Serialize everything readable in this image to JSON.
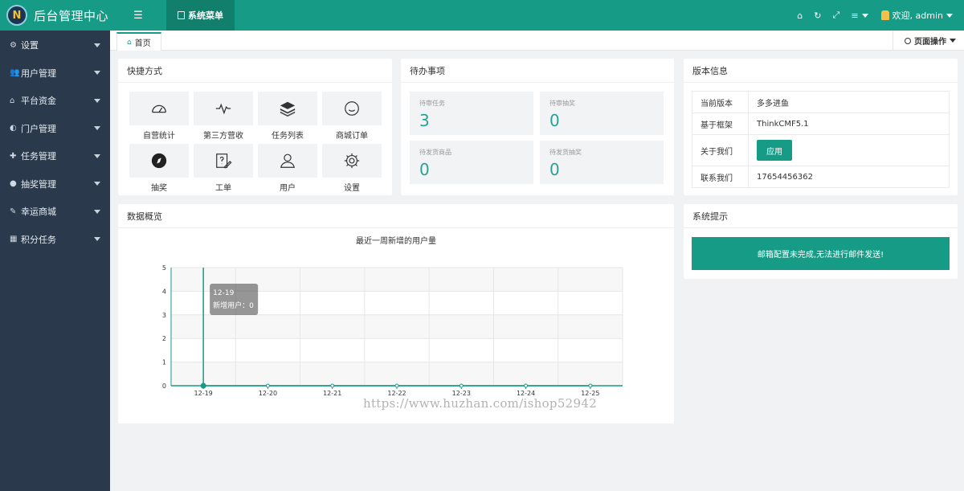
{
  "app": {
    "title": "后台管理中心",
    "logo_letter": "N"
  },
  "sidebar": {
    "items": [
      {
        "label": "设置",
        "icon": "gears-icon",
        "glyph": "⚙"
      },
      {
        "label": "用户管理",
        "icon": "users-icon",
        "glyph": "👥"
      },
      {
        "label": "平台资金",
        "icon": "bank-icon",
        "glyph": "⌂"
      },
      {
        "label": "门户管理",
        "icon": "portal-icon",
        "glyph": "◐"
      },
      {
        "label": "任务管理",
        "icon": "tasks-icon",
        "glyph": "✚"
      },
      {
        "label": "抽奖管理",
        "icon": "lottery-icon",
        "glyph": "●"
      },
      {
        "label": "幸运商城",
        "icon": "mall-icon",
        "glyph": "✎"
      },
      {
        "label": "积分任务",
        "icon": "grid-icon",
        "glyph": "▦"
      }
    ]
  },
  "topbar": {
    "toggle_glyph": "☰",
    "menu_label": "系统菜单",
    "user_label": "欢迎, admin"
  },
  "tabs": {
    "home_label": "首页",
    "page_ops_label": "页面操作"
  },
  "shortcuts": {
    "title": "快捷方式",
    "items": [
      {
        "label": "自营统计",
        "icon": "dashboard-icon"
      },
      {
        "label": "第三方营收",
        "icon": "pulse-icon"
      },
      {
        "label": "任务列表",
        "icon": "stack-icon"
      },
      {
        "label": "商城订单",
        "icon": "smile-icon"
      },
      {
        "label": "抽奖",
        "icon": "compass-icon"
      },
      {
        "label": "工单",
        "icon": "edit-doc-icon"
      },
      {
        "label": "用户",
        "icon": "user-icon"
      },
      {
        "label": "设置",
        "icon": "settings-icon"
      }
    ]
  },
  "todo": {
    "title": "待办事项",
    "items": [
      {
        "label": "待审任务",
        "value": "3"
      },
      {
        "label": "待审抽奖",
        "value": "0"
      },
      {
        "label": "待发货商品",
        "value": "0"
      },
      {
        "label": "待发货抽奖",
        "value": "0"
      }
    ]
  },
  "version": {
    "title": "版本信息",
    "rows": [
      {
        "key": "当前版本",
        "value": "多多进鱼"
      },
      {
        "key": "基于框架",
        "value": "ThinkCMF5.1"
      },
      {
        "key": "关于我们",
        "button": "应用"
      },
      {
        "key": "联系我们",
        "value": "17654456362"
      }
    ]
  },
  "overview": {
    "title": "数据概览"
  },
  "system_tip": {
    "title": "系统提示",
    "message": "邮箱配置未完成,无法进行邮件发送!"
  },
  "colors": {
    "brand": "#169b86",
    "sidebar": "#2a3a4c",
    "accent_text": "#2aa293"
  },
  "chart_data": {
    "type": "line",
    "title": "最近一周新增的用户量",
    "categories": [
      "12-19",
      "12-20",
      "12-21",
      "12-22",
      "12-23",
      "12-24",
      "12-25"
    ],
    "series": [
      {
        "name": "新增用户",
        "values": [
          0,
          0,
          0,
          0,
          0,
          0,
          0
        ]
      }
    ],
    "ylim": [
      0,
      5
    ],
    "yticks": [
      0,
      1,
      2,
      3,
      4,
      5
    ],
    "grid": true,
    "tooltip": {
      "title": "12-19",
      "series_label": "新增用户",
      "value": "0"
    }
  },
  "watermark": "https://www.huzhan.com/ishop52942"
}
